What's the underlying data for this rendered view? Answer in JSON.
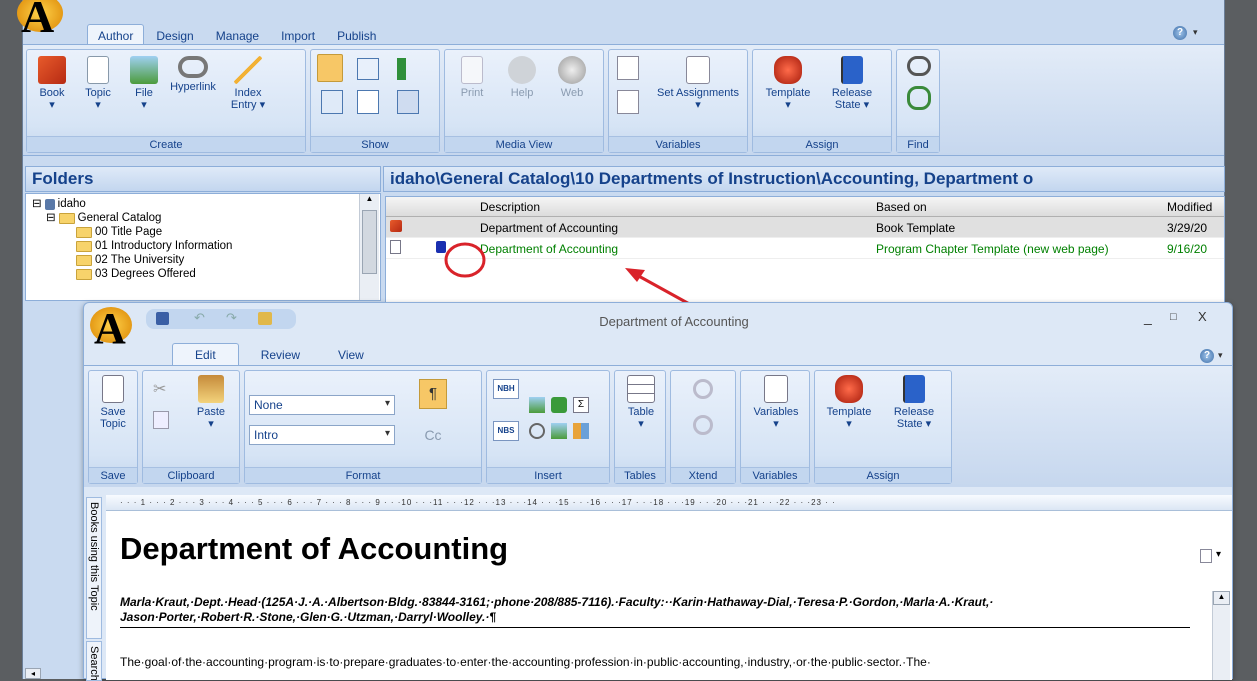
{
  "main_window": {
    "tabs": [
      "Author",
      "Design",
      "Manage",
      "Import",
      "Publish"
    ],
    "active_tab": "Author",
    "groups": {
      "create": {
        "label": "Create",
        "buttons": [
          "Book",
          "Topic",
          "File",
          "Hyperlink",
          "Index Entry ▾"
        ]
      },
      "show": {
        "label": "Show"
      },
      "media_view": {
        "label": "Media View",
        "buttons": [
          "Print",
          "Help",
          "Web"
        ]
      },
      "variables": {
        "label": "Variables",
        "buttons": [
          "Set Assignments ▾"
        ]
      },
      "assign": {
        "label": "Assign",
        "buttons": [
          "Template",
          "Release State ▾"
        ]
      },
      "find": {
        "label": "Find"
      }
    },
    "help_icon": "?"
  },
  "folders": {
    "title": "Folders",
    "tree": [
      {
        "label": "idaho",
        "level": 0,
        "expander": "⊟",
        "icon": "db-icon"
      },
      {
        "label": "General Catalog",
        "level": 1,
        "expander": "⊟",
        "icon": "folder-open-icon"
      },
      {
        "label": "00 Title Page",
        "level": 2,
        "icon": "folder-icon"
      },
      {
        "label": "01 Introductory Information",
        "level": 2,
        "icon": "folder-icon"
      },
      {
        "label": "02 The University",
        "level": 2,
        "icon": "folder-icon"
      },
      {
        "label": "03 Degrees Offered",
        "level": 2,
        "icon": "folder-icon"
      }
    ]
  },
  "content": {
    "path": "idaho\\General Catalog\\10 Departments of Instruction\\Accounting, Department o",
    "columns": [
      "Description",
      "Based on",
      "Modified"
    ],
    "rows": [
      {
        "description": "Department of Accounting",
        "based_on": "Book Template",
        "modified": "3/29/20",
        "color": "#000000",
        "icon": "book-icon",
        "locked": false
      },
      {
        "description": "Department of Accounting",
        "based_on": "Program Chapter Template (new web page)",
        "modified": "9/16/20",
        "color": "#008000",
        "icon": "page-icon",
        "locked": true
      }
    ]
  },
  "editor": {
    "title": "Department of Accounting",
    "tabs": [
      "Edit",
      "Review",
      "View"
    ],
    "active_tab": "Edit",
    "groups": {
      "save": {
        "label": "Save",
        "buttons": [
          "Save Topic"
        ]
      },
      "clipboard": {
        "label": "Clipboard",
        "buttons": [
          "Paste"
        ]
      },
      "format": {
        "label": "Format",
        "style1": "None",
        "style2": "Intro",
        "pilcrow": "¶",
        "case": "Cc"
      },
      "insert": {
        "label": "Insert",
        "nbh": "NBH",
        "nbs": "NBS",
        "sigma": "Σ"
      },
      "tables": {
        "label": "Tables",
        "buttons": [
          "Table"
        ]
      },
      "xtend": {
        "label": "Xtend"
      },
      "variables": {
        "label": "Variables",
        "buttons": [
          "Variables"
        ]
      },
      "assign": {
        "label": "Assign",
        "buttons": [
          "Template",
          "Release State ▾"
        ]
      }
    },
    "window_controls": [
      "_",
      "□",
      "X"
    ],
    "side_tabs": [
      "Books using this Topic",
      "Search"
    ],
    "ruler": "· · · 1 · · · 2 · · · 3 · · · 4 · · · 5 · · · 6 · · · 7 · · · 8 · · · 9 · · ·10 · · ·11 · · ·12 · · ·13 · · ·14 · · ·15 · · ·16 · · ·17 · · ·18 · · ·19 · · ·20 · · ·21 · · ·22 · · ·23 · ·",
    "heading": "Department of Accounting",
    "faculty_line": "Marla·Kraut,·Dept.·Head·(125A·J.·A.·Albertson·Bldg.·83844-3161;·phone·208/885-7116).·Faculty:··Karin·Hathaway-Dial,·Teresa·P.·Gordon,·Marla·A.·Kraut,· Jason·Porter,·Robert·R.·Stone,·Glen·G.·Utzman,·Darryl·Woolley.·¶",
    "body_line": "The·goal·of·the·accounting·program·is·to·prepare·graduates·to·enter·the·accounting·profession·in·public·accounting,·industry,·or·the·public·sector.·The·"
  },
  "colors": {
    "ribbon_blue": "#c9daf0",
    "text_blue": "#15428b",
    "annotation_red": "#d9232a",
    "green_text": "#008000"
  }
}
